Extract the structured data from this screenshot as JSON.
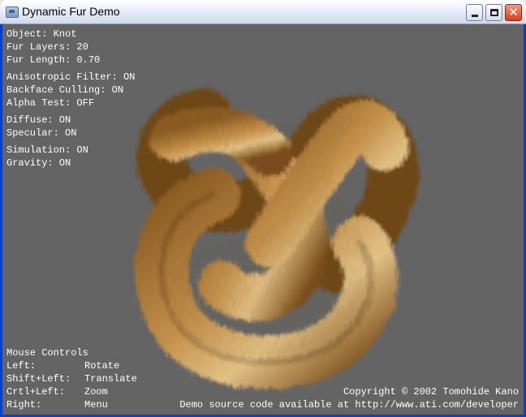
{
  "window": {
    "title": "Dynamic Fur Demo"
  },
  "status": {
    "object": "Object: Knot",
    "fur_layers": "Fur Layers: 20",
    "fur_length": "Fur Length: 0.70",
    "anisotropic": "Anisotropic Filter: ON",
    "backface": "Backface Culling: ON",
    "alpha_test": "Alpha Test: OFF",
    "diffuse": "Diffuse: ON",
    "specular": "Specular: ON",
    "simulation": "Simulation: ON",
    "gravity": "Gravity: ON"
  },
  "mouse_controls": {
    "header": "Mouse Controls",
    "rows": [
      {
        "key": "Left:",
        "action": "Rotate"
      },
      {
        "key": "Shift+Left:",
        "action": "Translate"
      },
      {
        "key": "Crtl+Left:",
        "action": "Zoom"
      },
      {
        "key": "Right:",
        "action": "Menu"
      }
    ]
  },
  "footer": {
    "copyright": "Copyright © 2002 Tomohide Kano",
    "source": "Demo source code available at http://www.ati.com/developer"
  },
  "colors": {
    "viewport_bg": "#646464",
    "fur_dark": "#5a3a12",
    "fur_mid": "#b07a36",
    "fur_light": "#e8c98a"
  }
}
